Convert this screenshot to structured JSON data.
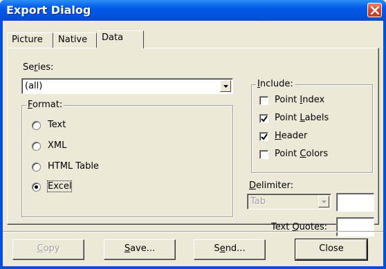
{
  "window": {
    "title": "Export Dialog"
  },
  "tabs": [
    "Picture",
    "Native",
    "Data"
  ],
  "series": {
    "label": "Series:",
    "value": "(all)"
  },
  "format": {
    "title": "Format:",
    "options": [
      "Text",
      "XML",
      "HTML Table",
      "Excel"
    ],
    "selected": "Excel"
  },
  "include": {
    "title": "Include:",
    "items": [
      {
        "label": "Point Index",
        "checked": false
      },
      {
        "label": "Point Labels",
        "checked": true
      },
      {
        "label": "Header",
        "checked": true
      },
      {
        "label": "Point Colors",
        "checked": false
      }
    ]
  },
  "delimiter": {
    "label": "Delimiter:",
    "value": "Tab",
    "custom": ""
  },
  "text_quotes": {
    "label": "Text Quotes:",
    "value": ""
  },
  "buttons": {
    "copy": "Copy",
    "save": "Save...",
    "send": "Send...",
    "close": "Close"
  }
}
